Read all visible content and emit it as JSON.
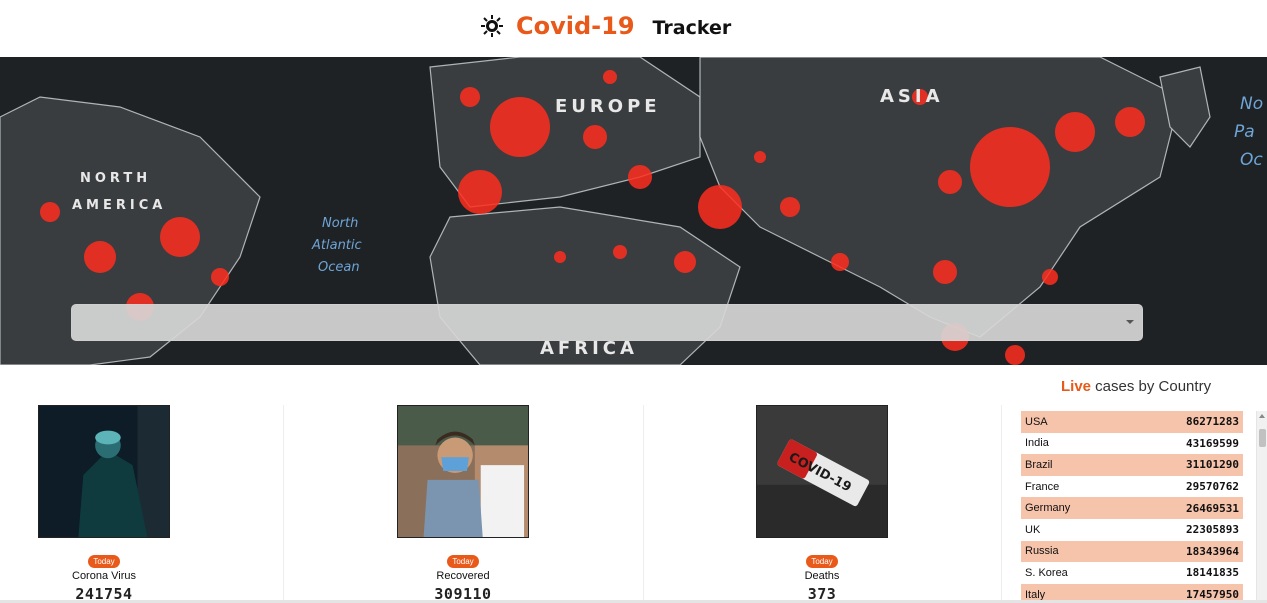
{
  "header": {
    "title": "Covid-19",
    "subtitle": "Tracker",
    "icon": "virus-icon"
  },
  "banner": {
    "map_labels": {
      "europe": "EUROPE",
      "asia": "ASIA",
      "north_america_1": "NORTH",
      "north_america_2": "AMERICA",
      "africa": "AFRICA",
      "ocean_1": "North",
      "ocean_2": "Atlantic",
      "ocean_3": "Ocean",
      "pacific_1": "No",
      "pacific_2": "Pa",
      "pacific_3": "Oc"
    },
    "select": {
      "selected_value": ""
    }
  },
  "cards": [
    {
      "badge": "Today",
      "label": "Corona Virus",
      "value": "241754"
    },
    {
      "badge": "Today",
      "label": "Recovered",
      "value": "309110"
    },
    {
      "badge": "Today",
      "label": "Deaths",
      "value": "373"
    }
  ],
  "card_images": {
    "third_text": "COVID-19"
  },
  "live": {
    "heading_accent": "Live",
    "heading_rest": " cases by Country",
    "rows": [
      {
        "country": "USA",
        "cases": "86271283"
      },
      {
        "country": "India",
        "cases": "43169599"
      },
      {
        "country": "Brazil",
        "cases": "31101290"
      },
      {
        "country": "France",
        "cases": "29570762"
      },
      {
        "country": "Germany",
        "cases": "26469531"
      },
      {
        "country": "UK",
        "cases": "22305893"
      },
      {
        "country": "Russia",
        "cases": "18343964"
      },
      {
        "country": "S. Korea",
        "cases": "18141835"
      },
      {
        "country": "Italy",
        "cases": "17457950"
      }
    ]
  },
  "colors": {
    "accent": "#e8591a",
    "row_highlight": "#f6c3ab",
    "map_bg": "#1e2224",
    "hotspot": "#ff2e1f"
  }
}
